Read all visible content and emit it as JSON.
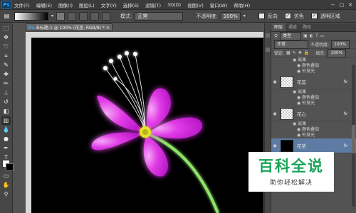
{
  "app": {
    "logo": "Ps"
  },
  "menu": [
    "文件(F)",
    "编辑(E)",
    "图像(I)",
    "图层(L)",
    "文字(Y)",
    "选择(S)",
    "滤镜(T)",
    "3D(D)",
    "视图(V)",
    "窗口(W)",
    "帮助(H)"
  ],
  "window_controls": [
    "−",
    "□",
    "✕"
  ],
  "options": {
    "mode_label": "模式:",
    "mode_value": "正常",
    "opacity_label": "不透明度:",
    "opacity_value": "100%",
    "reverse_label": "反向",
    "dither_label": "仿色",
    "transparency_label": "透明区域",
    "checkbox_states": {
      "reverse": false,
      "dither": true,
      "transparency": true
    }
  },
  "document": {
    "tab_title": "未标题-1 @ 100% (花茎, RGB/8) *",
    "close": "×"
  },
  "panel": {
    "tabs": [
      "图层",
      "通道",
      "路径"
    ],
    "kind_label": "类型",
    "blend_mode": "正常",
    "opacity_label": "不透明度:",
    "opacity_value": "100%",
    "lock_label": "锁定:",
    "fill_label": "填充:",
    "fill_value": "100%",
    "layers": [
      {
        "type": "sub",
        "level": 1,
        "text": "效果"
      },
      {
        "type": "sub",
        "level": 2,
        "text": "颜色叠加"
      },
      {
        "type": "sub",
        "level": 2,
        "text": "外发光"
      },
      {
        "type": "layer",
        "name": "花蕊",
        "fx": "fx",
        "thumb": "checker"
      },
      {
        "type": "sub",
        "level": 1,
        "text": "效果"
      },
      {
        "type": "sub",
        "level": 2,
        "text": "颜色叠加"
      },
      {
        "type": "sub",
        "level": 2,
        "text": "外发光"
      },
      {
        "type": "layer",
        "name": "花心",
        "fx": "fx",
        "thumb": "checker"
      },
      {
        "type": "sub",
        "level": 1,
        "text": "效果"
      },
      {
        "type": "sub",
        "level": 2,
        "text": "颜色叠加"
      },
      {
        "type": "sub",
        "level": 2,
        "text": "外发光"
      },
      {
        "type": "layer",
        "name": "花茎",
        "fx": "fx",
        "thumb": "black",
        "selected": true
      }
    ]
  },
  "watermark": {
    "title": "百科全说",
    "subtitle": "助你轻松解决"
  },
  "colors": {
    "accent": "#31a8ff",
    "petal": "#e13be6",
    "stem": "#8fe36a",
    "center": "#e6e02a",
    "watermark_green": "#1aa35a"
  },
  "icons": [
    "marquee-icon",
    "move-icon",
    "lasso-icon",
    "crop-icon",
    "eyedropper-icon",
    "healing-icon",
    "brush-icon",
    "stamp-icon",
    "history-brush-icon",
    "eraser-icon",
    "gradient-icon",
    "blur-icon",
    "dodge-icon",
    "pen-icon",
    "type-icon",
    "path-select-icon",
    "shape-icon",
    "hand-icon",
    "zoom-icon",
    "eye-icon"
  ]
}
